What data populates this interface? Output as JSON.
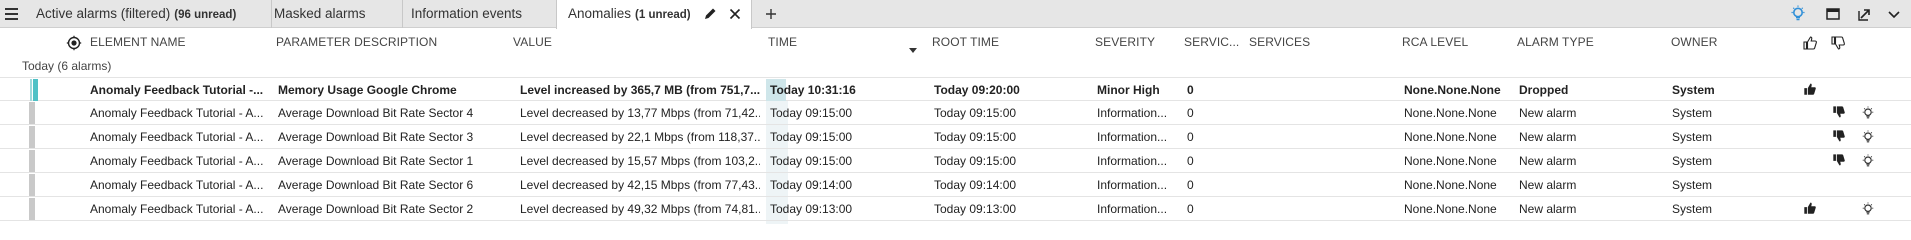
{
  "tabs": [
    {
      "label": "Active alarms (filtered)",
      "badge": "(96 unread)",
      "active": false
    },
    {
      "label": "Masked alarms",
      "badge": "",
      "active": false
    },
    {
      "label": "Information events",
      "badge": "",
      "active": false
    },
    {
      "label": "Anomalies",
      "badge": "(1 unread)",
      "active": true
    }
  ],
  "columns": {
    "element_name": "ELEMENT NAME",
    "parameter_description": "PARAMETER DESCRIPTION",
    "value": "VALUE",
    "time": "TIME",
    "root_time": "ROOT TIME",
    "severity": "SEVERITY",
    "servic": "SERVIC...",
    "services": "SERVICES",
    "rca_level": "RCA LEVEL",
    "alarm_type": "ALARM TYPE",
    "owner": "OWNER"
  },
  "group": {
    "label": "Today (6 alarms)"
  },
  "rows": [
    {
      "element": "Anomaly Feedback Tutorial -...",
      "parameter": "Memory Usage Google Chrome",
      "value": "Level increased by 365,7 MB (from 751,7...",
      "time": "Today 10:31:16",
      "root_time": "Today 09:20:00",
      "severity": "Minor High",
      "servic": "0",
      "services": "",
      "rca": "None.None.None",
      "alarm_type": "Dropped",
      "owner": "System",
      "bold": true,
      "thumb_up": true,
      "thumb_down": false,
      "bulb": false
    },
    {
      "element": "Anomaly Feedback Tutorial - A...",
      "parameter": "Average Download Bit Rate Sector 4",
      "value": "Level decreased by 13,77 Mbps (from 71,42...",
      "time": "Today 09:15:00",
      "root_time": "Today 09:15:00",
      "severity": "Information...",
      "servic": "0",
      "services": "",
      "rca": "None.None.None",
      "alarm_type": "New alarm",
      "owner": "System",
      "bold": false,
      "thumb_up": false,
      "thumb_down": true,
      "bulb": true
    },
    {
      "element": "Anomaly Feedback Tutorial - A...",
      "parameter": "Average Download Bit Rate Sector 3",
      "value": "Level decreased by 22,1 Mbps (from 118,37...",
      "time": "Today 09:15:00",
      "root_time": "Today 09:15:00",
      "severity": "Information...",
      "servic": "0",
      "services": "",
      "rca": "None.None.None",
      "alarm_type": "New alarm",
      "owner": "System",
      "bold": false,
      "thumb_up": false,
      "thumb_down": true,
      "bulb": true
    },
    {
      "element": "Anomaly Feedback Tutorial - A...",
      "parameter": "Average Download Bit Rate Sector 1",
      "value": "Level decreased by 15,57 Mbps (from 103,2...",
      "time": "Today 09:15:00",
      "root_time": "Today 09:15:00",
      "severity": "Information...",
      "servic": "0",
      "services": "",
      "rca": "None.None.None",
      "alarm_type": "New alarm",
      "owner": "System",
      "bold": false,
      "thumb_up": false,
      "thumb_down": true,
      "bulb": true
    },
    {
      "element": "Anomaly Feedback Tutorial - A...",
      "parameter": "Average Download Bit Rate Sector 6",
      "value": "Level decreased by 42,15 Mbps (from 77,43...",
      "time": "Today 09:14:00",
      "root_time": "Today 09:14:00",
      "severity": "Information...",
      "servic": "0",
      "services": "",
      "rca": "None.None.None",
      "alarm_type": "New alarm",
      "owner": "System",
      "bold": false,
      "thumb_up": false,
      "thumb_down": false,
      "bulb": false
    },
    {
      "element": "Anomaly Feedback Tutorial - A...",
      "parameter": "Average Download Bit Rate Sector 2",
      "value": "Level decreased by 49,32 Mbps (from 74,81...",
      "time": "Today 09:13:00",
      "root_time": "Today 09:13:00",
      "severity": "Information...",
      "servic": "0",
      "services": "",
      "rca": "None.None.None",
      "alarm_type": "New alarm",
      "owner": "System",
      "bold": false,
      "thumb_up": true,
      "thumb_down": false,
      "bulb": true
    }
  ],
  "colors": {
    "accent": "#4fc1c6",
    "tab_bg": "#e6e6e6",
    "row_border": "#e4e4e4",
    "bulb_blue": "#2f8fd8"
  },
  "icons": [
    "menu-icon",
    "edit-icon",
    "close-icon",
    "add-tab-icon",
    "lightbulb-icon",
    "window-icon",
    "popout-icon",
    "chevron-down-icon",
    "column-select-icon",
    "sort-down-icon",
    "thumbs-up-icon",
    "thumbs-down-icon"
  ]
}
